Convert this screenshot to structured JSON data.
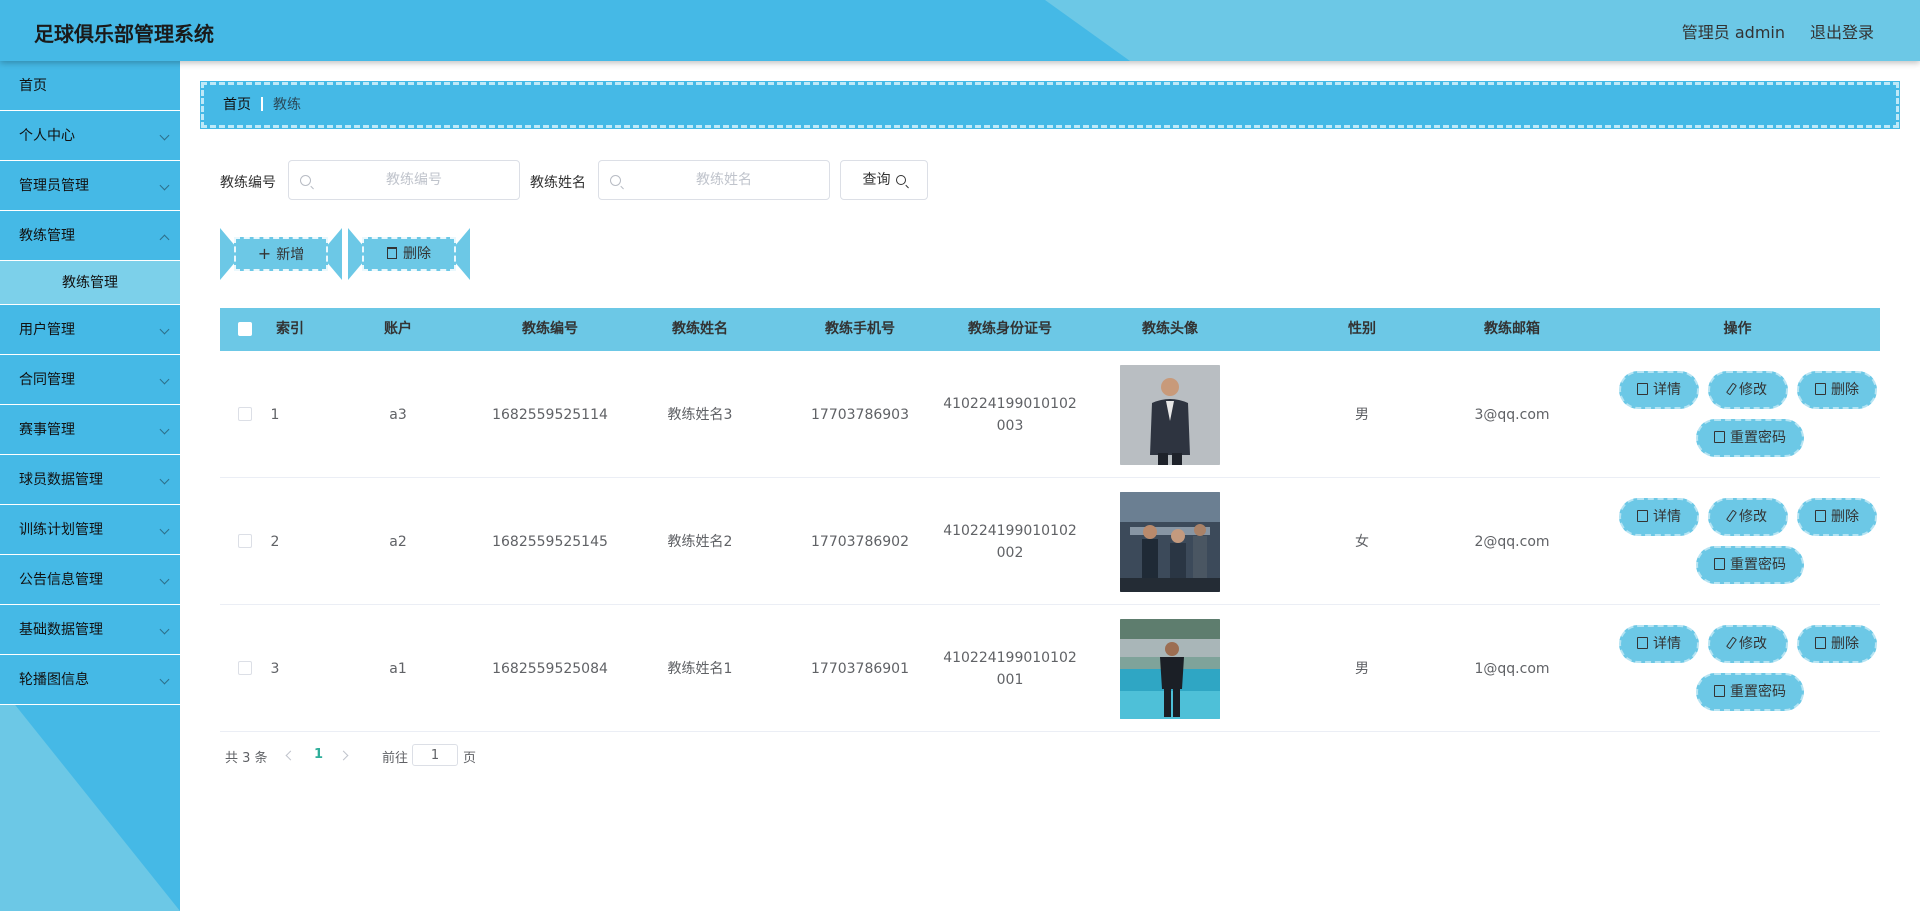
{
  "header": {
    "title": "足球俱乐部管理系统",
    "user_label": "管理员 admin",
    "logout_label": "退出登录"
  },
  "sidebar": {
    "items": [
      {
        "label": "首页"
      },
      {
        "label": "个人中心"
      },
      {
        "label": "管理员管理"
      },
      {
        "label": "教练管理"
      },
      {
        "label": "用户管理"
      },
      {
        "label": "合同管理"
      },
      {
        "label": "赛事管理"
      },
      {
        "label": "球员数据管理"
      },
      {
        "label": "训练计划管理"
      },
      {
        "label": "公告信息管理"
      },
      {
        "label": "基础数据管理"
      },
      {
        "label": "轮播图信息"
      }
    ],
    "submenu_label": "教练管理"
  },
  "breadcrumb": {
    "home": "首页",
    "current": "教练"
  },
  "search": {
    "field1_label": "教练编号",
    "field1_placeholder": "教练编号",
    "field1_value": "",
    "field2_label": "教练姓名",
    "field2_placeholder": "教练姓名",
    "field2_value": "",
    "query_label": "查询"
  },
  "actions": {
    "add_label": "新增",
    "delete_label": "删除"
  },
  "table": {
    "columns": [
      "索引",
      "账户",
      "教练编号",
      "教练姓名",
      "教练手机号",
      "教练身份证号",
      "教练头像",
      "性别",
      "教练邮箱",
      "操作"
    ],
    "rows": [
      {
        "index": "1",
        "account": "a3",
        "code": "1682559525114",
        "name": "教练姓名3",
        "phone": "17703786903",
        "id_line1": "410224199010102",
        "id_line2": "003",
        "gender": "男",
        "email": "3@qq.com"
      },
      {
        "index": "2",
        "account": "a2",
        "code": "1682559525145",
        "name": "教练姓名2",
        "phone": "17703786902",
        "id_line1": "410224199010102",
        "id_line2": "002",
        "gender": "女",
        "email": "2@qq.com"
      },
      {
        "index": "3",
        "account": "a1",
        "code": "1682559525084",
        "name": "教练姓名1",
        "phone": "17703786901",
        "id_line1": "410224199010102",
        "id_line2": "001",
        "gender": "男",
        "email": "1@qq.com"
      }
    ],
    "op_labels": {
      "detail": "详情",
      "edit": "修改",
      "delete": "删除",
      "reset": "重置密码"
    }
  },
  "pagination": {
    "total_label": "共 3 条",
    "current_page": "1",
    "goto_label": "前往",
    "goto_value": "1",
    "page_suffix": "页"
  },
  "colors": {
    "primary": "#45b9e6",
    "accent_light": "#6cc8e6",
    "active_page": "#2fae9a"
  }
}
